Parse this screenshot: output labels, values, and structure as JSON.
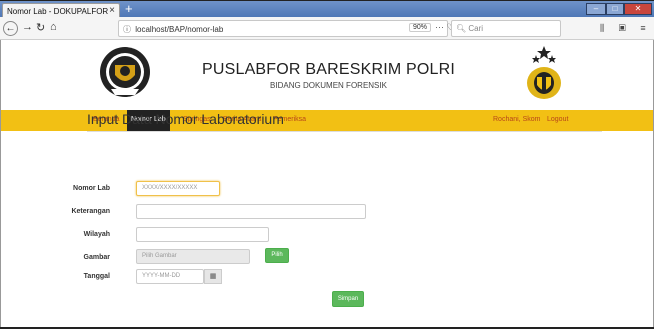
{
  "browser": {
    "tab_title": "Nomor Lab - DOKUPALFOR",
    "tab_close": "×",
    "new_tab": "+",
    "url": "localhost/BAP/nomor-lab",
    "zoom": "90%",
    "url_actions": "··· ♡ ☆",
    "search_placeholder": "Cari"
  },
  "header": {
    "title": "PUSLABFOR BARESKRIM POLRI",
    "subtitle": "BIDANG DOKUMEN FORENSIK"
  },
  "menu": {
    "beranda": "Beranda",
    "nomor_lab": "Nomor Lab",
    "springas": "Springas",
    "berita_acara": "Berita Acara",
    "pemeriksa": "Pemeriksa",
    "user": "Rochani, Skom",
    "logout": "Logout"
  },
  "form": {
    "title": "Input Data Nomor Laboratorium",
    "nomor_lab_label": "Nomor Lab",
    "nomor_lab_placeholder": "XXXX/XXXX/XXXXX",
    "keterangan_label": "Keterangan",
    "wilayah_label": "Wilayah",
    "gambar_label": "Gambar",
    "gambar_placeholder": "Pilih Gambar",
    "pilih_button": "Pilih",
    "tanggal_label": "Tanggal",
    "tanggal_placeholder": "YYYY-MM-DD",
    "simpan_button": "Simpan"
  }
}
